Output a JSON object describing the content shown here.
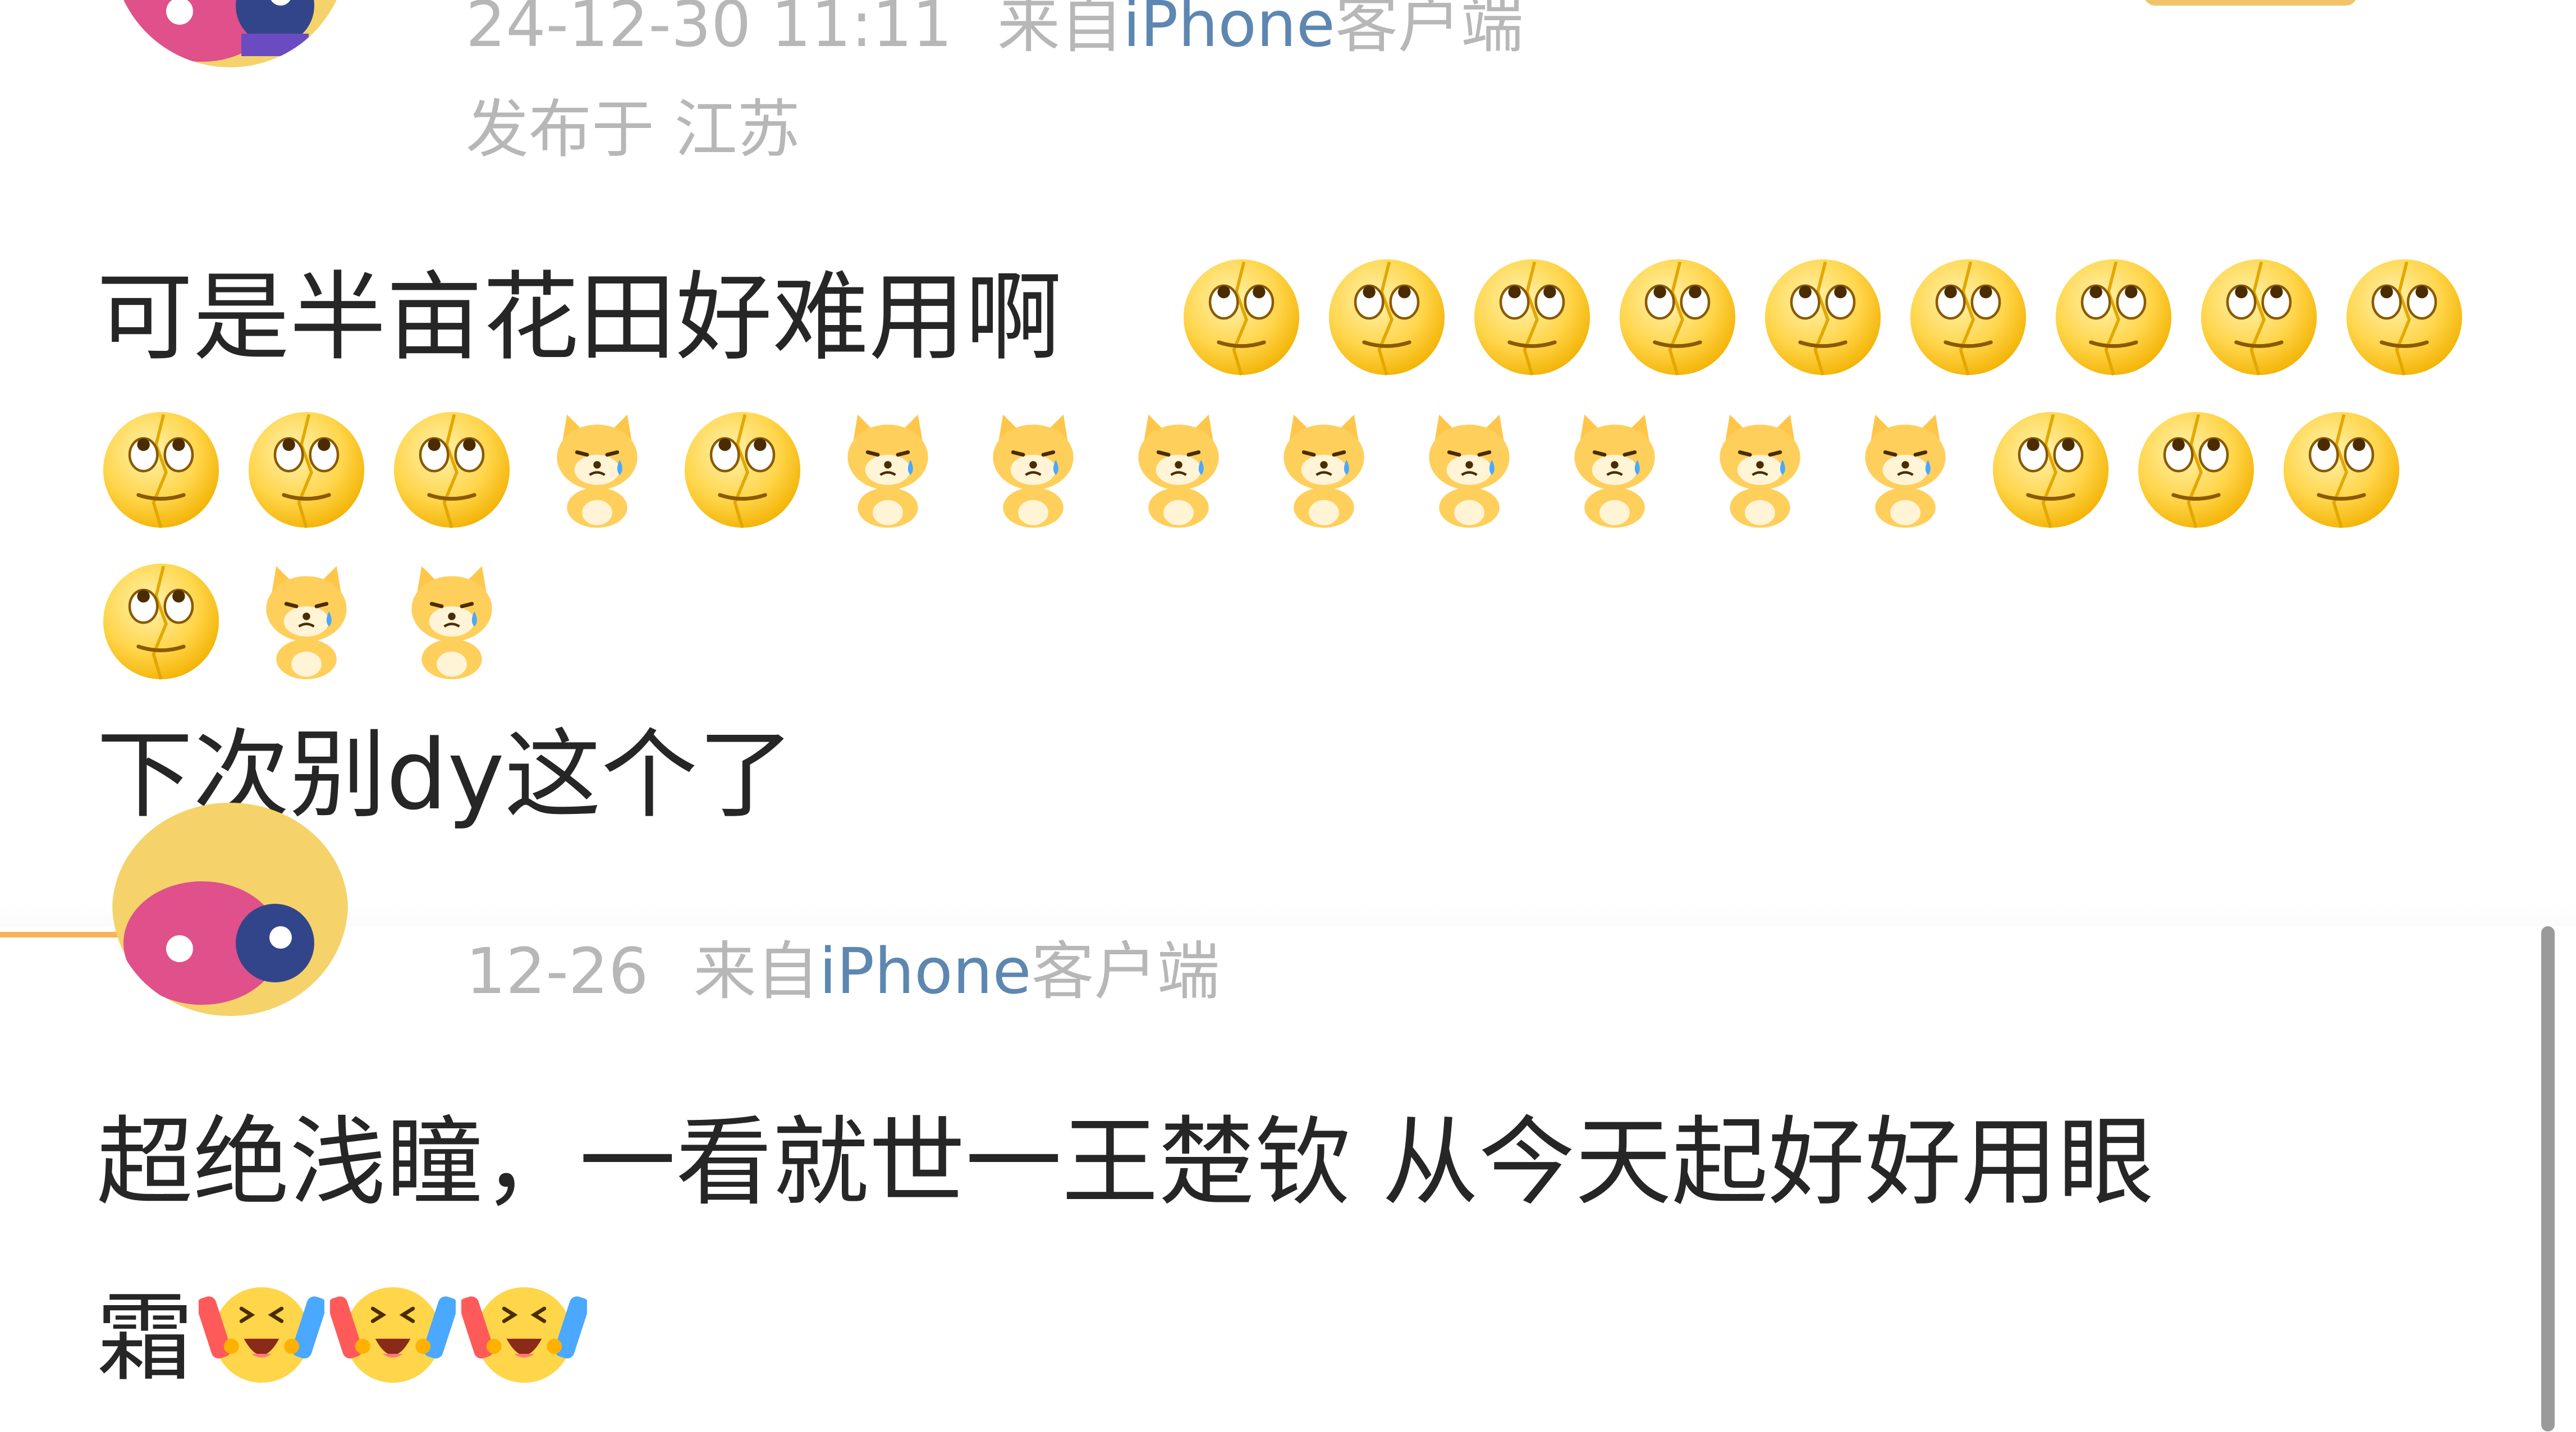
{
  "comments": [
    {
      "meta": {
        "time": "24-12-30 11:11",
        "source_prefix": "来自",
        "device": "iPhone",
        "device_suffix": "客户端",
        "location": "发布于 江苏"
      },
      "text_line1": "可是半亩花田好难用啊",
      "text_line2": "下次别dy这个了",
      "emojis_row1": [
        "eye-roll-emoji",
        "eye-roll-emoji",
        "eye-roll-emoji",
        "eye-roll-emoji",
        "eye-roll-emoji",
        "eye-roll-emoji",
        "eye-roll-emoji",
        "eye-roll-emoji",
        "eye-roll-emoji"
      ],
      "emojis_row2": [
        "eye-roll-emoji",
        "eye-roll-emoji",
        "eye-roll-emoji",
        "crying-dog-emoji",
        "eye-roll-emoji",
        "crying-dog-emoji",
        "crying-dog-emoji",
        "crying-dog-emoji",
        "crying-dog-emoji",
        "crying-dog-emoji",
        "crying-dog-emoji",
        "crying-dog-emoji",
        "crying-dog-emoji",
        "eye-roll-emoji",
        "eye-roll-emoji",
        "eye-roll-emoji"
      ],
      "emojis_row3": [
        "eye-roll-emoji",
        "crying-dog-emoji",
        "crying-dog-emoji"
      ]
    },
    {
      "meta": {
        "time": "12-26",
        "source_prefix": "来自",
        "device": "iPhone",
        "device_suffix": "客户端"
      },
      "text_line1": "超绝浅瞳，一看就世一王楚钦 从今天起好好用眼",
      "text_line2": "霜",
      "emojis_inline": [
        "cheering-emoji",
        "cheering-emoji",
        "cheering-emoji"
      ]
    }
  ],
  "colors": {
    "text": "#262626",
    "meta": "#b7b7b7",
    "device_link": "#5d87b0",
    "emoji_yellow": "#ffd54a"
  }
}
